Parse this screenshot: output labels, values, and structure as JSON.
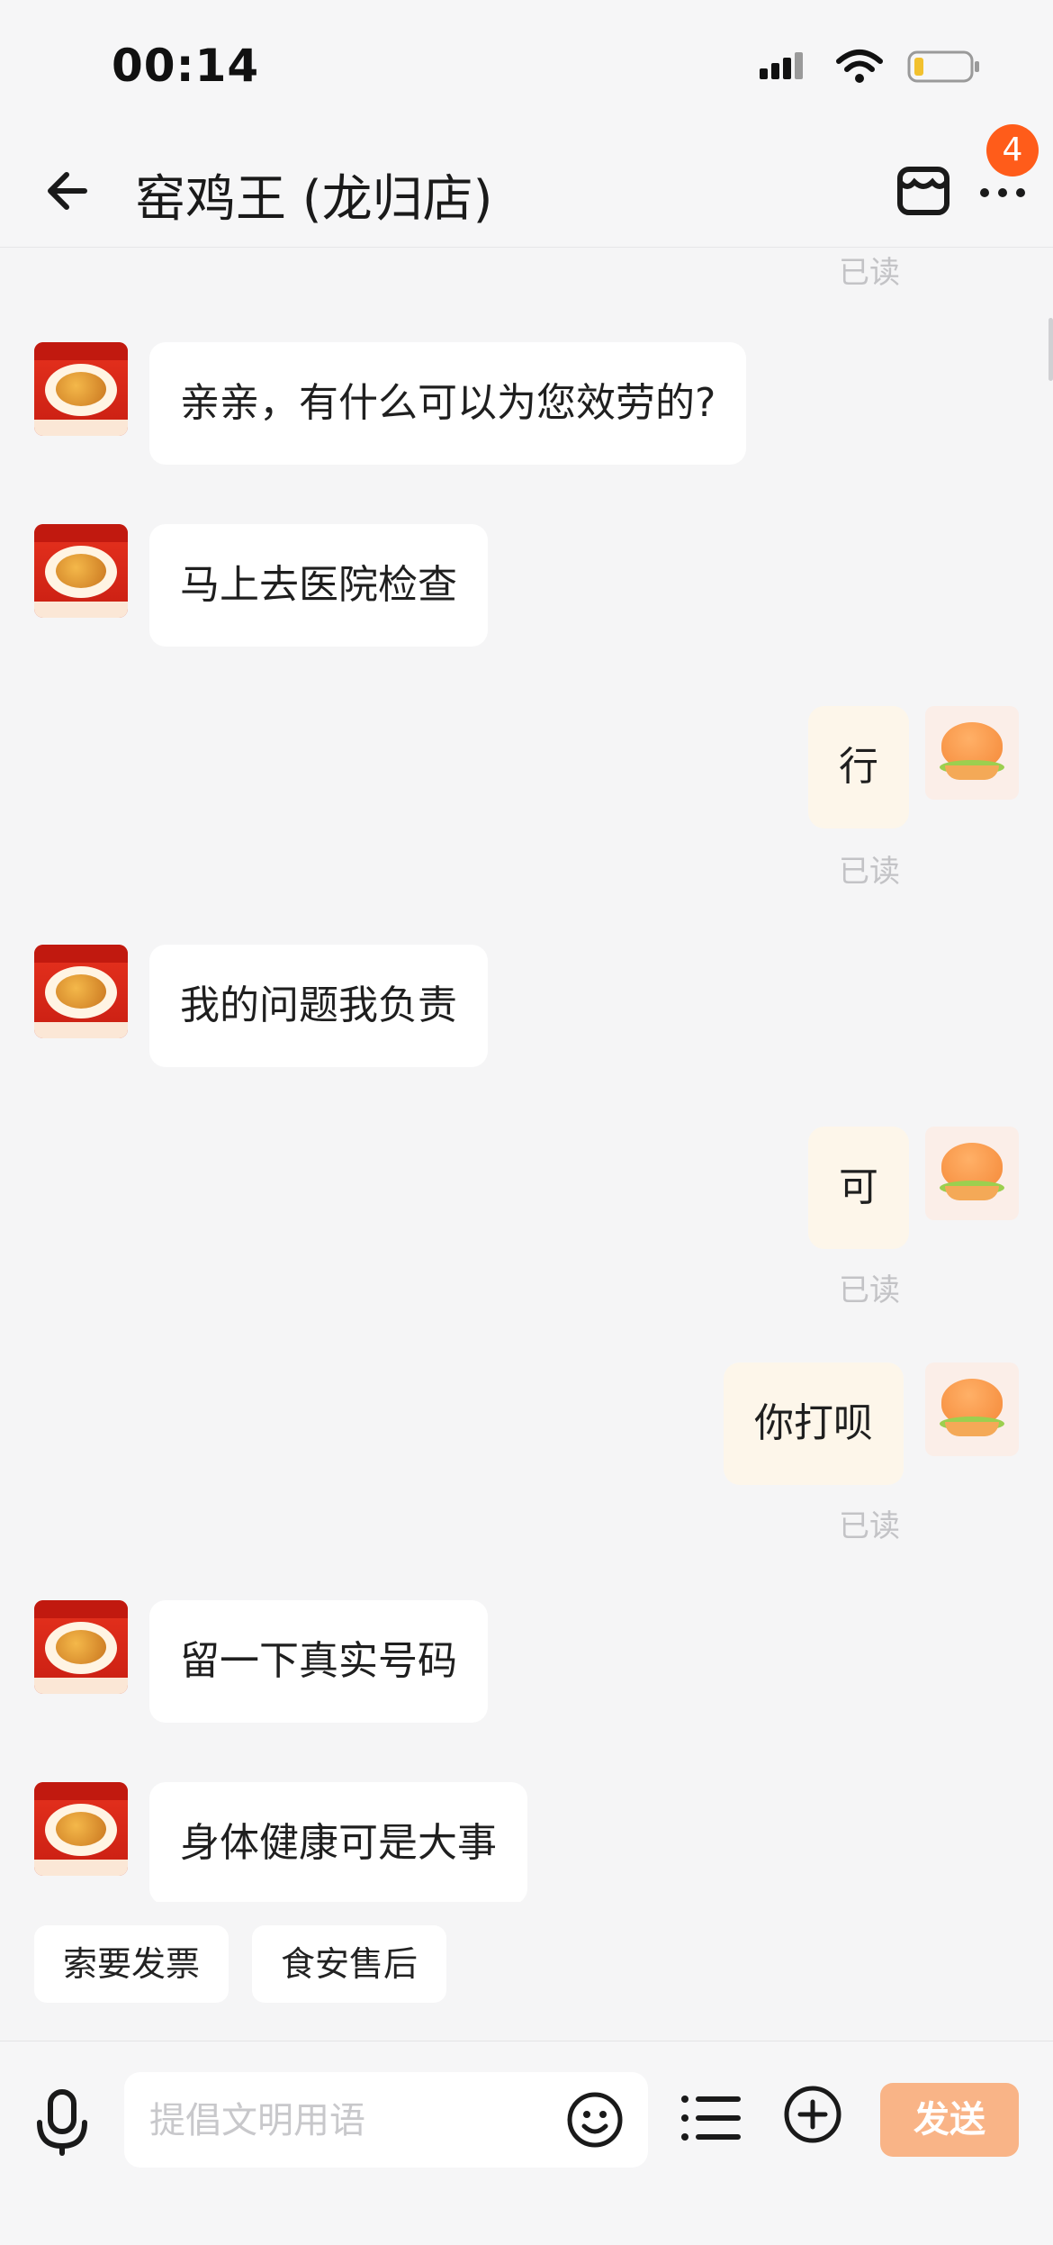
{
  "status_bar": {
    "time": "00:14",
    "icons": [
      "signal-icon",
      "wifi-icon",
      "battery-icon"
    ]
  },
  "header": {
    "title": "窑鸡王 (龙归店)",
    "back_icon": "back-arrow-icon",
    "store_icon": "store-icon",
    "more_icon": "more-icon",
    "badge_count": "4"
  },
  "messages": [
    {
      "side": "status",
      "text": "已读"
    },
    {
      "side": "in",
      "text": "亲亲，有什么可以为您效劳的?"
    },
    {
      "side": "in",
      "text": "马上去医院检查"
    },
    {
      "side": "out",
      "text": "行",
      "read": "已读"
    },
    {
      "side": "in",
      "text": "我的问题我负责"
    },
    {
      "side": "out",
      "text": "可",
      "read": "已读"
    },
    {
      "side": "out",
      "text": "你打呗",
      "read": "已读"
    },
    {
      "side": "in",
      "text": "留一下真实号码"
    },
    {
      "side": "in",
      "text": "身体健康可是大事"
    }
  ],
  "quick_replies": [
    "索要发票",
    "食安售后"
  ],
  "composer": {
    "placeholder": "提倡文明用语",
    "send_label": "发送"
  },
  "colors": {
    "accent_orange": "#ff5c1a",
    "send_button": "#f9b487",
    "outgoing_bubble": "#fdf6ea",
    "background": "#f5f5f6"
  }
}
